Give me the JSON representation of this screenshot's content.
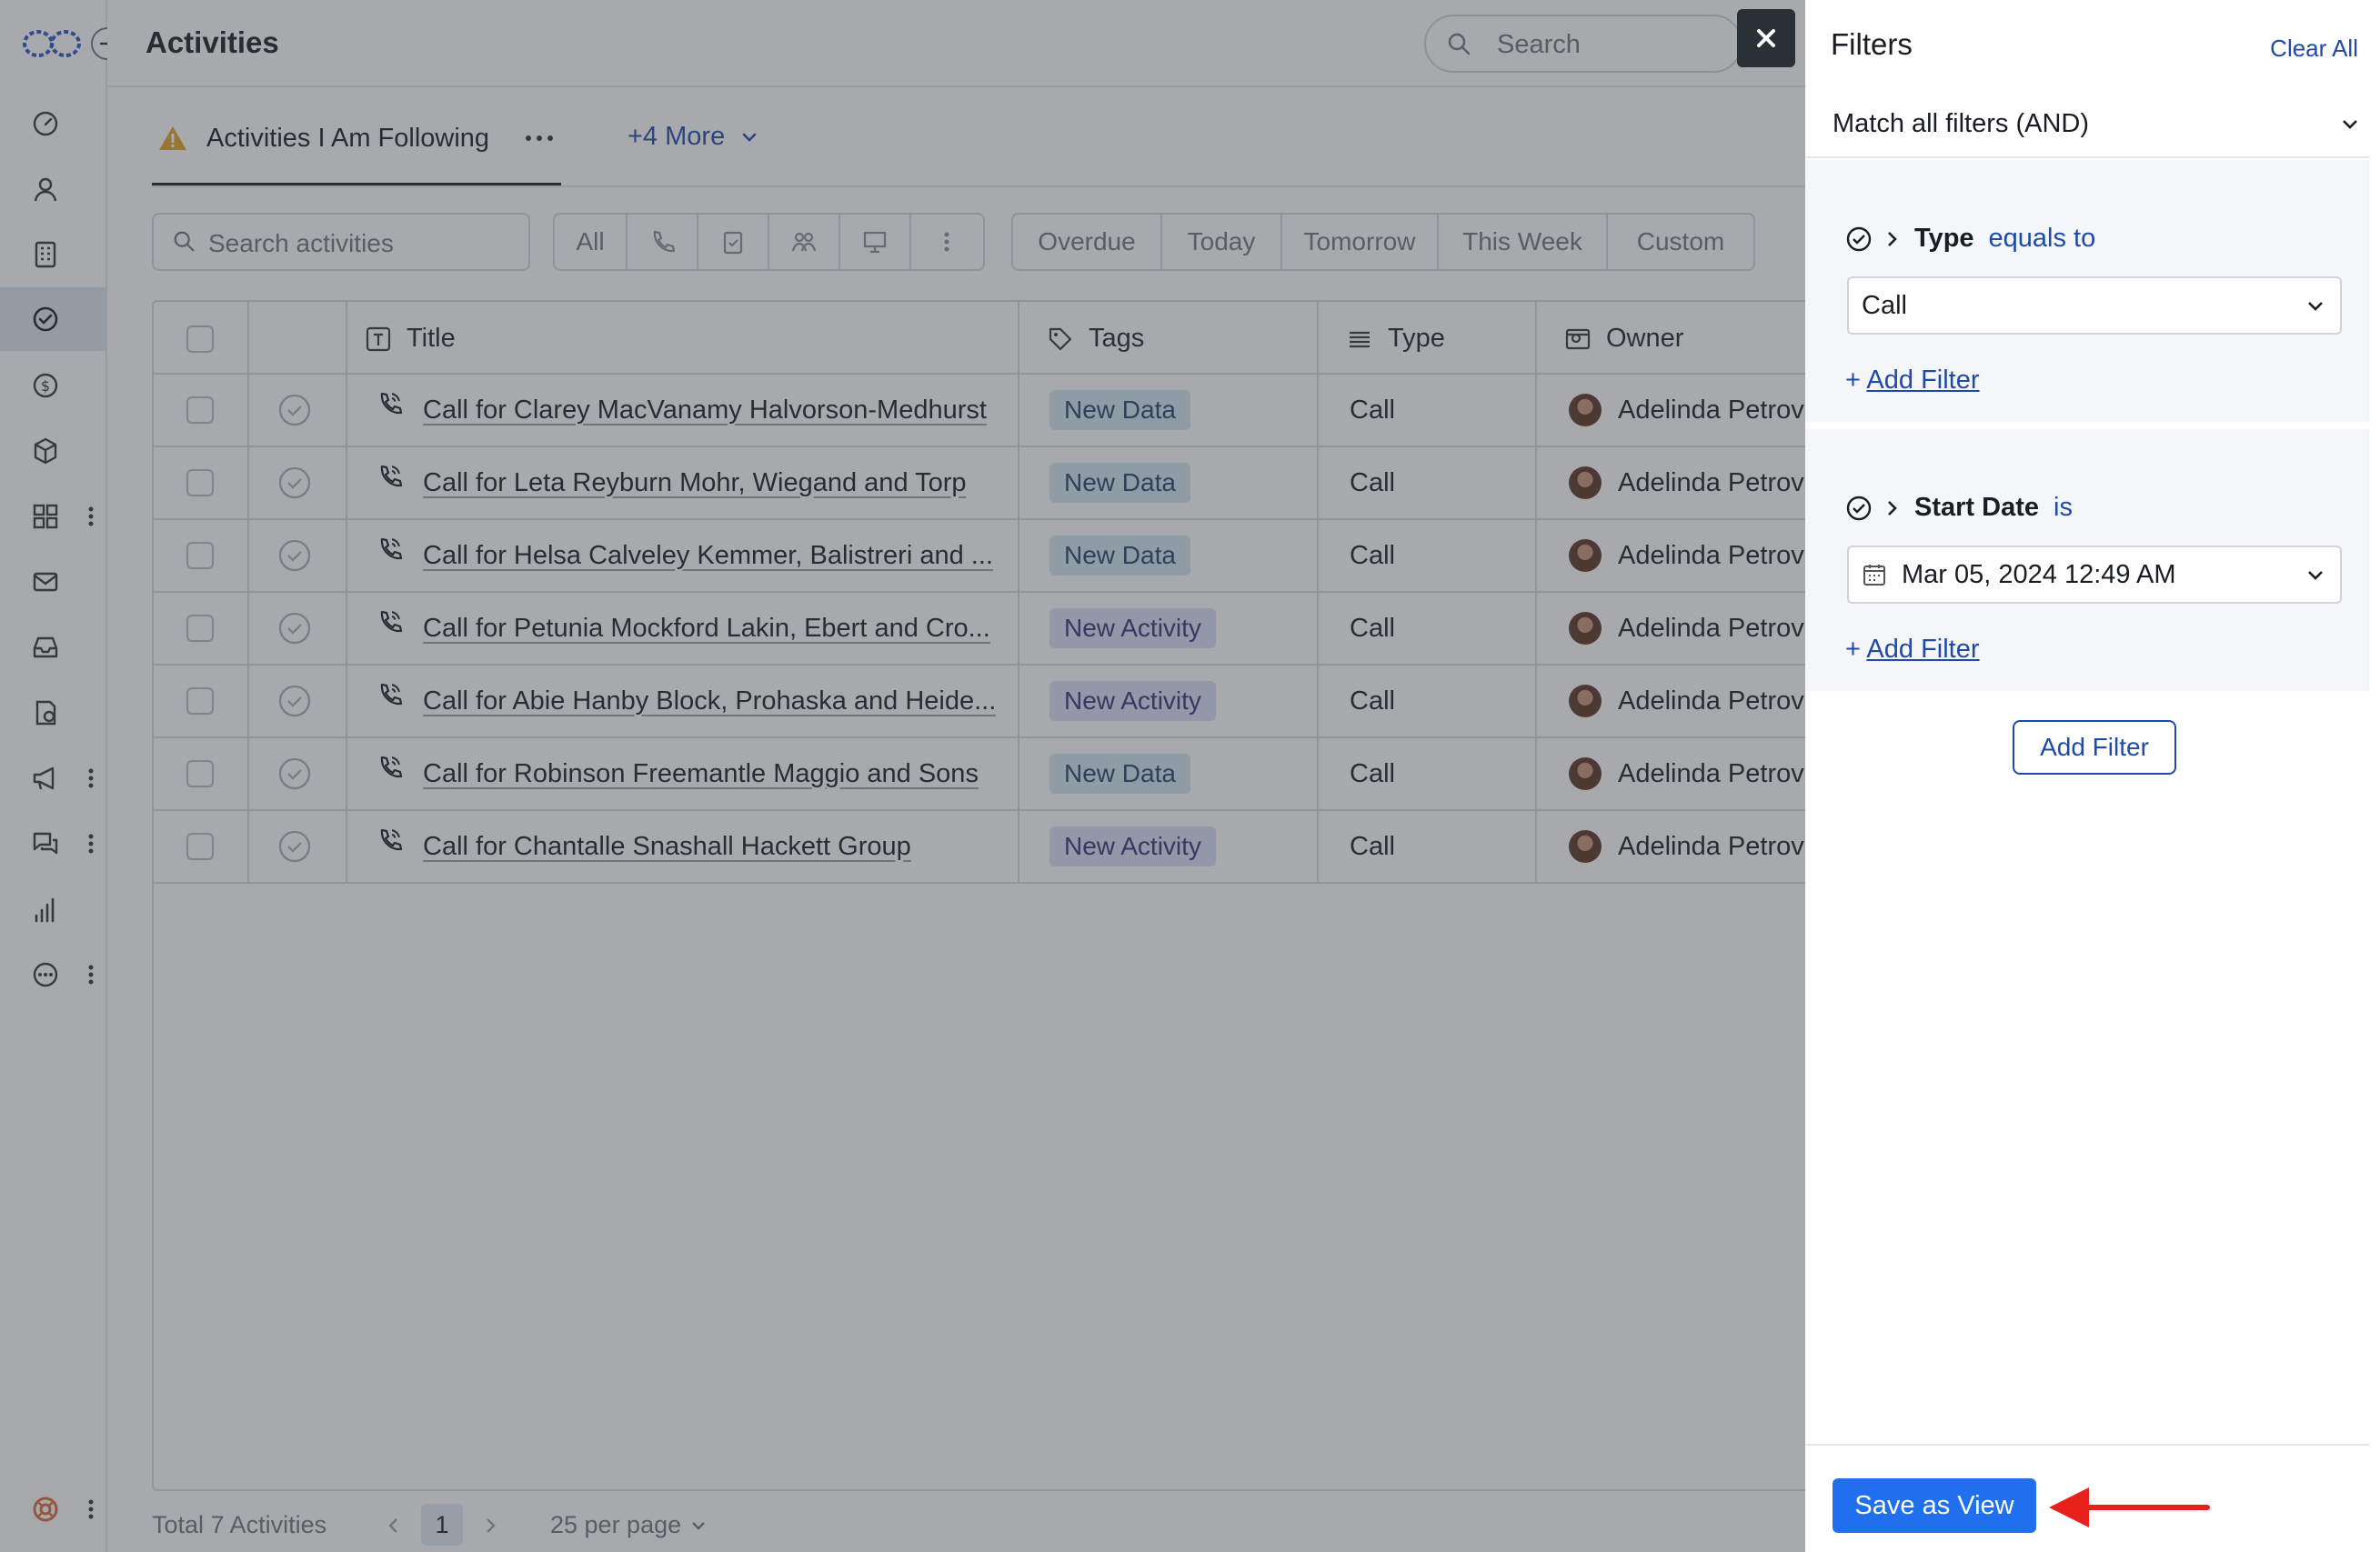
{
  "header": {
    "title": "Activities",
    "search_placeholder": "Search"
  },
  "views": {
    "current": "Activities I Am Following",
    "more": "+4 More"
  },
  "toolbar": {
    "search_placeholder": "Search activities",
    "type_filters": [
      "All"
    ],
    "date_filters": [
      "Overdue",
      "Today",
      "Tomorrow",
      "This Week",
      "Custom"
    ]
  },
  "table": {
    "columns": [
      "Title",
      "Tags",
      "Type",
      "Owner"
    ],
    "rows": [
      {
        "title": "Call for Clarey MacVanamy Halvorson-Medhurst",
        "tag": "New Data",
        "type": "Call",
        "owner": "Adelinda Petrovi"
      },
      {
        "title": "Call for Leta Reyburn Mohr, Wiegand and Torp",
        "tag": "New Data",
        "type": "Call",
        "owner": "Adelinda Petrovi"
      },
      {
        "title": "Call for Helsa Calveley Kemmer, Balistreri and ...",
        "tag": "New Data",
        "type": "Call",
        "owner": "Adelinda Petrovi"
      },
      {
        "title": "Call for Petunia Mockford Lakin, Ebert and Cro...",
        "tag": "New Activity",
        "type": "Call",
        "owner": "Adelinda Petrovi"
      },
      {
        "title": "Call for Abie Hanby Block, Prohaska and Heide...",
        "tag": "New Activity",
        "type": "Call",
        "owner": "Adelinda Petrovi"
      },
      {
        "title": "Call for Robinson Freemantle Maggio and Sons",
        "tag": "New Data",
        "type": "Call",
        "owner": "Adelinda Petrovi"
      },
      {
        "title": "Call for Chantalle Snashall Hackett Group",
        "tag": "New Activity",
        "type": "Call",
        "owner": "Adelinda Petrovi"
      }
    ]
  },
  "footer": {
    "total": "Total 7 Activities",
    "page": "1",
    "per_page": "25 per page"
  },
  "filters": {
    "title": "Filters",
    "clear_all": "Clear All",
    "match": "Match all filters (AND)",
    "groups": [
      {
        "field": "Type",
        "operator": "equals to",
        "value": "Call",
        "add": "Add Filter"
      },
      {
        "field": "Start Date",
        "operator": "is",
        "value": "Mar 05, 2024 12:49 AM",
        "add": "Add Filter"
      }
    ],
    "add_filter_button": "Add Filter",
    "save_view": "Save as View"
  },
  "colors": {
    "accent": "#1f6fee",
    "link": "#1f4aa8",
    "arrow": "#e8211c"
  }
}
